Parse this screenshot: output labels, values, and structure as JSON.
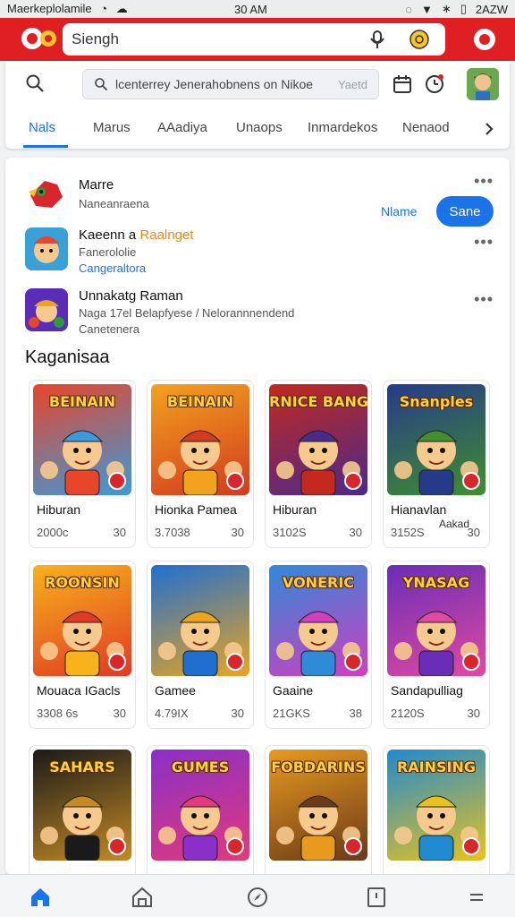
{
  "status_bar": {
    "carrier": "Maerkeplolamile",
    "time": "30 AM",
    "battery": "2AZW"
  },
  "header": {
    "search_placeholder": "Siengh"
  },
  "toolbar": {
    "search_text": "lcenterrey Jenerahobnens on Nikoe",
    "search_hint": "Yaetd"
  },
  "tabs": [
    {
      "label": "Nals",
      "active": true
    },
    {
      "label": "Marus",
      "active": false
    },
    {
      "label": "AAadiya",
      "active": false
    },
    {
      "label": "Unaops",
      "active": false
    },
    {
      "label": "Inmardekos",
      "active": false
    },
    {
      "label": "Nenaod",
      "active": false
    }
  ],
  "list_items": [
    {
      "title": "Marre",
      "subtitle": "Naneanraena",
      "secondary_action": "Nlame",
      "primary_action": "Sane"
    },
    {
      "title": "Kaeenn a ",
      "title_highlight": "Raalnget",
      "subtitle": "Fanerololie",
      "link": "Cangeraltora"
    },
    {
      "title": "Unnakatg Raman",
      "subtitle": "Naga 17el Belapfyese / Nelorannnendend",
      "subtitle2": "Canetenera"
    }
  ],
  "section_title": "Kaganisaa",
  "games": [
    {
      "art_title": "BEINAIN",
      "name": "Hiburan",
      "size": "2000c",
      "rating": "30",
      "colors": [
        "#e8452a",
        "#3b9ad9"
      ]
    },
    {
      "art_title": "BEINAIN",
      "name": "Hionka Pamea",
      "size": "3.7038",
      "rating": "30",
      "colors": [
        "#f2a21e",
        "#d33a1f"
      ]
    },
    {
      "art_title": "RNICE BANGLS",
      "name": "Hiburan",
      "size": "3102S",
      "rating": "30",
      "colors": [
        "#c4281f",
        "#4a2a8a"
      ]
    },
    {
      "art_title": "Snanples",
      "name": "Hianavlan",
      "size": "3152S",
      "rating": "30",
      "extra": "Aakad",
      "colors": [
        "#263a8a",
        "#3f8f2f"
      ]
    },
    {
      "art_title": "ROONSIN",
      "name": "Mouaca IGacls",
      "size": "3308 6s",
      "rating": "30",
      "colors": [
        "#f7b21c",
        "#e03a24"
      ]
    },
    {
      "art_title": "",
      "name": "Gamee",
      "size": "4.79IX",
      "rating": "30",
      "colors": [
        "#1f6fd1",
        "#e8a51f"
      ]
    },
    {
      "art_title": "VONERIC",
      "name": "Gaaine",
      "size": "21GKS",
      "rating": "38",
      "colors": [
        "#2f8ad8",
        "#cf3fbf"
      ]
    },
    {
      "art_title": "YNASAG",
      "name": "Sandapulliag",
      "size": "2120S",
      "rating": "30",
      "colors": [
        "#6a2db8",
        "#e04aa0"
      ]
    },
    {
      "art_title": "SAHARS",
      "name": "",
      "size": "",
      "rating": "",
      "colors": [
        "#1a1a1a",
        "#c48a24"
      ]
    },
    {
      "art_title": "GUMES",
      "name": "",
      "size": "",
      "rating": "",
      "colors": [
        "#8a2fc9",
        "#e23a7a"
      ]
    },
    {
      "art_title": "FOBDARINS",
      "name": "",
      "size": "",
      "rating": "",
      "colors": [
        "#e89a1e",
        "#6a3a1a"
      ]
    },
    {
      "art_title": "RAINSING",
      "name": "",
      "size": "",
      "rating": "",
      "colors": [
        "#1f8ad0",
        "#e8c21e"
      ]
    }
  ],
  "colors": {
    "brand_red": "#e01f24",
    "accent_blue": "#1a73e8"
  },
  "icons": {
    "bottom_nav": [
      "home-icon",
      "store-icon",
      "compass-icon",
      "book-icon",
      "menu-icon"
    ]
  }
}
